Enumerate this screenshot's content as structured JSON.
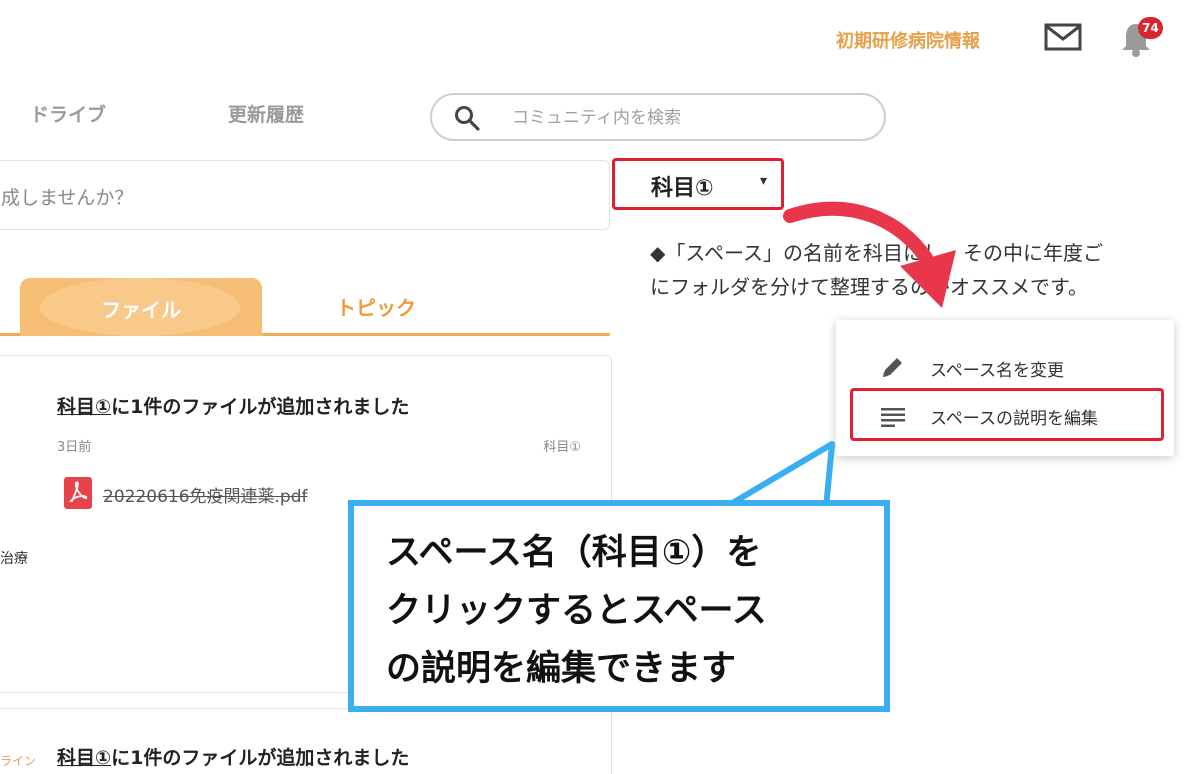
{
  "header": {
    "hospital_info_link": "初期研修病院情報",
    "notification_count": "74"
  },
  "nav": {
    "drive": "ドライブ",
    "history": "更新履歴"
  },
  "search": {
    "placeholder": "コミュニティ内を検索"
  },
  "post_box": {
    "placeholder": "成しませんか？"
  },
  "tabs": {
    "file": "ファイル",
    "topic": "トピック"
  },
  "feed": {
    "items": [
      {
        "space_link": "科目①",
        "title_rest": "に1件のファイルが追加されました",
        "time": "3日前",
        "space": "科目①",
        "file_name": "20220616免疫関連薬.pdf"
      },
      {
        "space_link": "科目①",
        "title_rest": "に1件のファイルが追加されました"
      }
    ],
    "side_text": "治療",
    "side_text2": "ライン"
  },
  "space": {
    "title": "科目①",
    "caret": "▾",
    "description_line1": "◆「スペース」の名前を科目にし、その中に年度ご",
    "description_line2": "にフォルダを分けて整理するのがオススメです。"
  },
  "dropdown": {
    "rename": "スペース名を変更",
    "edit_description": "スペースの説明を編集"
  },
  "callout": {
    "line1": "スペース名（科目①）を",
    "line2": "クリックするとスペース",
    "line3": "の説明を編集できます"
  },
  "colors": {
    "accent_orange": "#f09a37",
    "highlight_red": "#e02030",
    "callout_blue": "#3aaef0"
  },
  "icons": [
    "mail-icon",
    "bell-icon",
    "search-icon",
    "pdf-icon",
    "pencil-icon",
    "text-lines-icon",
    "caret-down-icon"
  ]
}
